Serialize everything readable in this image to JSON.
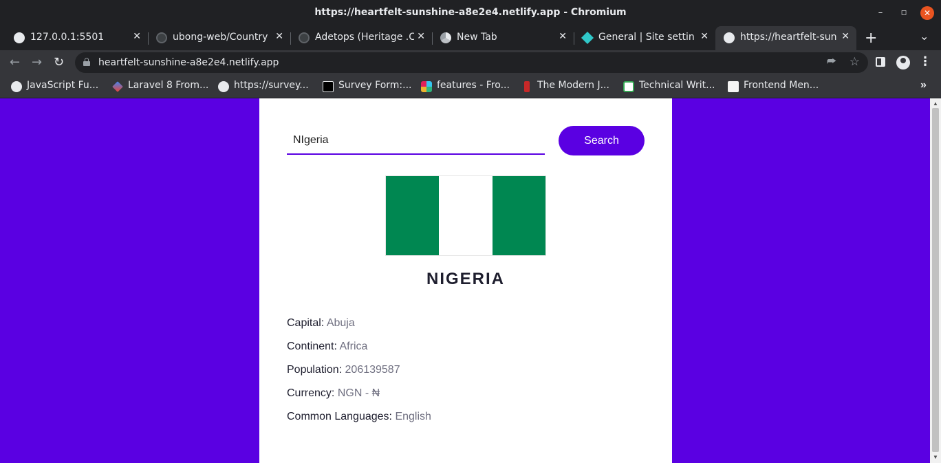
{
  "window": {
    "title": "https://heartfelt-sunshine-a8e2e4.netlify.app - Chromium",
    "minimize_icon": "–",
    "maximize_icon": "◻",
    "close_icon": "✕"
  },
  "tabs": [
    {
      "label": "127.0.0.1:5501",
      "icon": "globe-icon",
      "active": false
    },
    {
      "label": "ubong-web/Country",
      "icon": "github-icon",
      "active": false
    },
    {
      "label": "Adetops (Heritage .C",
      "icon": "github-icon",
      "active": false
    },
    {
      "label": "New Tab",
      "icon": "chrome-icon",
      "active": false
    },
    {
      "label": "General | Site setting",
      "icon": "netlify-icon",
      "active": false
    },
    {
      "label": "https://heartfelt-sun",
      "icon": "globe-icon",
      "active": true
    }
  ],
  "tab_close_glyph": "✕",
  "new_tab_glyph": "+",
  "tab_menu_glyph": "⌄",
  "toolbar": {
    "back_glyph": "←",
    "forward_glyph": "→",
    "reload_glyph": "↻",
    "url": "heartfelt-sunshine-a8e2e4.netlify.app",
    "share_glyph": "⮫",
    "star_glyph": "☆",
    "menu_glyph": "⋮"
  },
  "bookmarks": [
    {
      "label": "JavaScript Fu...",
      "icon": "globe-icon"
    },
    {
      "label": "Laravel 8 From...",
      "icon": "laravel-icon"
    },
    {
      "label": "https://survey...",
      "icon": "globe-icon"
    },
    {
      "label": "Survey Form:...",
      "icon": "codepen-icon"
    },
    {
      "label": "features - Fro...",
      "icon": "slack-icon"
    },
    {
      "label": "The Modern J...",
      "icon": "javascript-info-icon"
    },
    {
      "label": "Technical Writ...",
      "icon": "code-icon"
    },
    {
      "label": "Frontend Men...",
      "icon": "frontend-mentor-icon"
    }
  ],
  "bookmarks_more_glyph": "»",
  "app": {
    "search": {
      "value": "NIgeria",
      "button_label": "Search"
    },
    "country_name": "NIGERIA",
    "flag_colors": [
      "#008751",
      "#ffffff",
      "#008751"
    ],
    "details": [
      {
        "label": "Capital:",
        "value": "Abuja"
      },
      {
        "label": "Continent:",
        "value": "Africa"
      },
      {
        "label": "Population:",
        "value": "206139587"
      },
      {
        "label": "Currency:",
        "value": "NGN - ₦"
      },
      {
        "label": "Common Languages:",
        "value": "English"
      }
    ]
  },
  "colors": {
    "background_purple": "#5a00e2",
    "accent": "#5a00e2",
    "card": "#ffffff"
  }
}
